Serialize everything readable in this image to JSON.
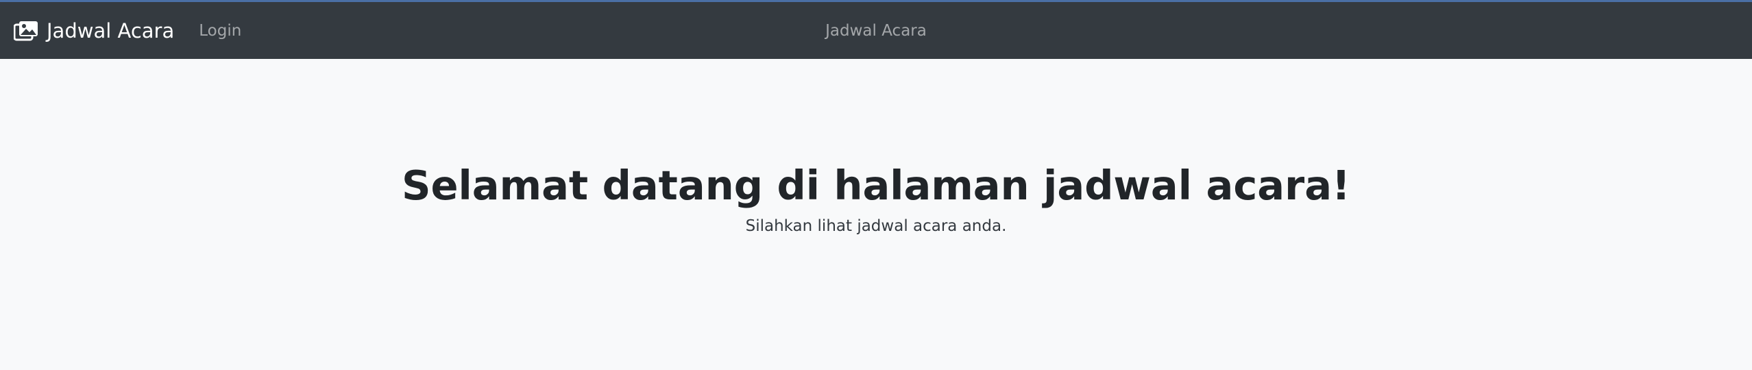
{
  "navbar": {
    "brand_label": "Jadwal Acara",
    "brand_icon": "images-icon",
    "login_label": "Login",
    "center_title": "Jadwal Acara"
  },
  "hero": {
    "heading": "Selamat datang di halaman jadwal acara!",
    "subtext": "Silahkan lihat jadwal acara anda."
  },
  "colors": {
    "navbar_bg": "#343a40",
    "page_bg": "#f8f9fa",
    "text": "#212529"
  }
}
